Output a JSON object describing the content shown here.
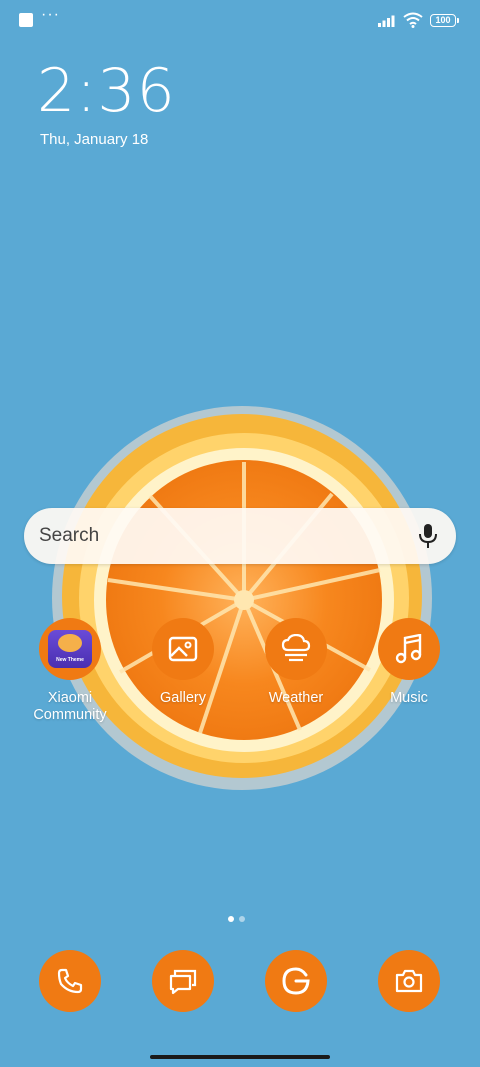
{
  "status_bar": {
    "overflow_dots": "···",
    "battery_level": "100"
  },
  "lockscreen": {
    "time": "2:36",
    "date": "Thu, January 18"
  },
  "search": {
    "placeholder": "Search"
  },
  "apps": [
    {
      "label_line1": "Xiaomi",
      "label_line2": "Community",
      "icon": "xiaomi-community-icon",
      "badge_text": "New Theme"
    },
    {
      "label": "Gallery",
      "icon": "gallery-icon"
    },
    {
      "label": "Weather",
      "icon": "weather-icon"
    },
    {
      "label": "Music",
      "icon": "music-icon"
    }
  ],
  "dock": [
    {
      "icon": "phone-icon"
    },
    {
      "icon": "messages-icon"
    },
    {
      "icon": "google-icon"
    },
    {
      "icon": "camera-icon"
    }
  ],
  "pages": {
    "total": 2,
    "current": 1
  },
  "colors": {
    "background": "#5aa9d4",
    "accent": "#f07a13"
  }
}
